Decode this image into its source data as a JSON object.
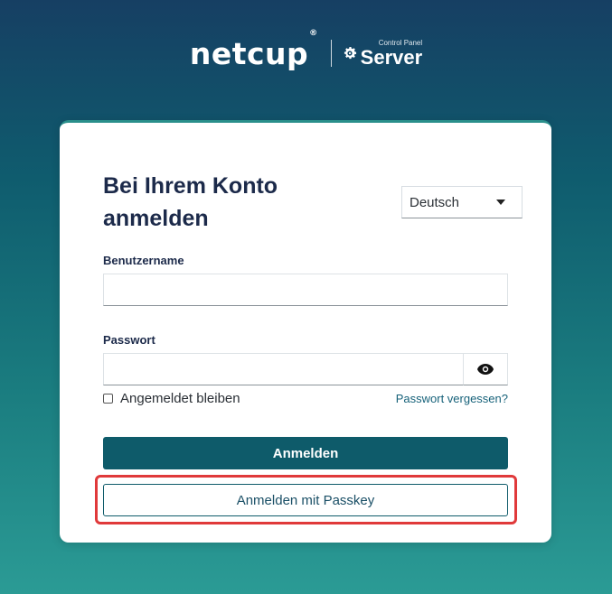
{
  "header": {
    "brand": "netcup",
    "registered_mark": "®",
    "control_panel_label": "Control Panel",
    "server_label": "Server"
  },
  "login": {
    "title_line1": "Bei Ihrem Konto",
    "title_line2": "anmelden",
    "language": "Deutsch",
    "username_label": "Benutzername",
    "username_value": "",
    "password_label": "Passwort",
    "password_value": "",
    "remember_label": "Angemeldet bleiben",
    "remember_checked": false,
    "forgot_link": "Passwort vergessen?",
    "submit_label": "Anmelden",
    "passkey_label": "Anmelden mit Passkey"
  },
  "colors": {
    "primary": "#0e5b6a",
    "title": "#1c2a4a",
    "link": "#17627a",
    "highlight": "#e0393a"
  },
  "icons": [
    "gear-icon",
    "eye-icon",
    "caret-down-icon"
  ]
}
